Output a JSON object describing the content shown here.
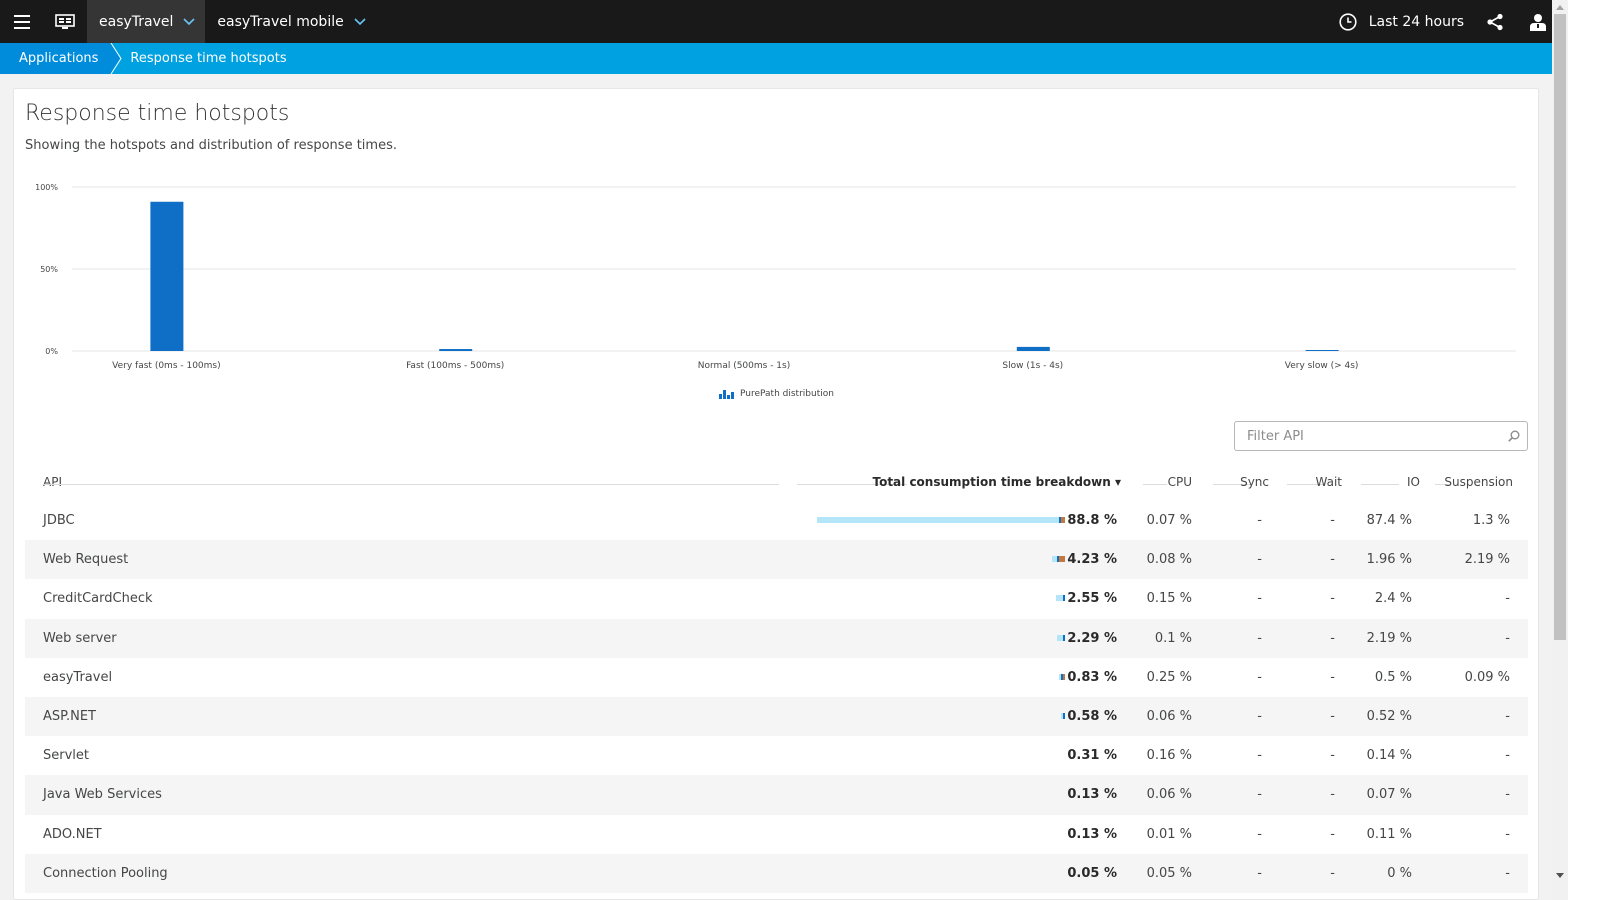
{
  "topbar": {
    "apps": [
      {
        "label": "easyTravel",
        "active": true
      },
      {
        "label": "easyTravel mobile",
        "active": false
      }
    ],
    "timeframe": "Last 24 hours"
  },
  "breadcrumb": {
    "items": [
      "Applications",
      "Response time hotspots"
    ]
  },
  "page": {
    "title": "Response time hotspots",
    "subtitle": "Showing the hotspots and distribution of response times."
  },
  "chart_data": {
    "type": "bar",
    "categories": [
      "Very fast (0ms - 100ms)",
      "Fast (100ms - 500ms)",
      "Normal (500ms - 1s)",
      "Slow (1s - 4s)",
      "Very slow (> 4s)"
    ],
    "values": [
      91,
      1.2,
      0,
      2.5,
      0.6
    ],
    "ytick_labels": [
      "100%",
      "50%",
      "0%"
    ],
    "ylim": [
      0,
      100
    ],
    "yticks": [
      100,
      50,
      0
    ],
    "grid": true,
    "legend": [
      "PurePath distribution"
    ],
    "legend_position": "bottom-center",
    "colors": {
      "bar": "#0f6fc6",
      "grid": "#e6e6e6"
    }
  },
  "filter": {
    "placeholder": "Filter API"
  },
  "table": {
    "headers": {
      "api": "API",
      "total": "Total consumption time breakdown ▾",
      "cpu": "CPU",
      "sync": "Sync",
      "wait": "Wait",
      "io": "IO",
      "suspension": "Suspension"
    },
    "rows": [
      {
        "api": "JDBC",
        "total": "88.8 %",
        "cpu": "0.07 %",
        "sync": "-",
        "wait": "-",
        "io": "87.4 %",
        "suspension": "1.3 %",
        "bar": {
          "io": 87.4,
          "cpu": 0.07,
          "susp": 1.3
        }
      },
      {
        "api": "Web Request",
        "total": "4.23 %",
        "cpu": "0.08 %",
        "sync": "-",
        "wait": "-",
        "io": "1.96 %",
        "suspension": "2.19 %",
        "bar": {
          "io": 1.96,
          "cpu": 0.08,
          "susp": 2.19
        }
      },
      {
        "api": "CreditCardCheck",
        "total": "2.55 %",
        "cpu": "0.15 %",
        "sync": "-",
        "wait": "-",
        "io": "2.4 %",
        "suspension": "-",
        "bar": {
          "io": 2.4,
          "cpu": 0.15,
          "susp": 0
        }
      },
      {
        "api": "Web server",
        "total": "2.29 %",
        "cpu": "0.1 %",
        "sync": "-",
        "wait": "-",
        "io": "2.19 %",
        "suspension": "-",
        "bar": {
          "io": 2.19,
          "cpu": 0.1,
          "susp": 0
        }
      },
      {
        "api": "easyTravel",
        "total": "0.83 %",
        "cpu": "0.25 %",
        "sync": "-",
        "wait": "-",
        "io": "0.5 %",
        "suspension": "0.09 %",
        "bar": {
          "io": 0.5,
          "cpu": 0.25,
          "susp": 0.09
        }
      },
      {
        "api": "ASP.NET",
        "total": "0.58 %",
        "cpu": "0.06 %",
        "sync": "-",
        "wait": "-",
        "io": "0.52 %",
        "suspension": "-",
        "bar": {
          "io": 0.52,
          "cpu": 0.06,
          "susp": 0
        }
      },
      {
        "api": "Servlet",
        "total": "0.31 %",
        "cpu": "0.16 %",
        "sync": "-",
        "wait": "-",
        "io": "0.14 %",
        "suspension": "-",
        "bar": null
      },
      {
        "api": "Java Web Services",
        "total": "0.13 %",
        "cpu": "0.06 %",
        "sync": "-",
        "wait": "-",
        "io": "0.07 %",
        "suspension": "-",
        "bar": null
      },
      {
        "api": "ADO.NET",
        "total": "0.13 %",
        "cpu": "0.01 %",
        "sync": "-",
        "wait": "-",
        "io": "0.11 %",
        "suspension": "-",
        "bar": null
      },
      {
        "api": "Connection Pooling",
        "total": "0.05 %",
        "cpu": "0.05 %",
        "sync": "-",
        "wait": "-",
        "io": "0 %",
        "suspension": "-",
        "bar": null
      }
    ]
  },
  "icons": [
    "hamburger-menu-icon",
    "monitor-icon",
    "chevron-down-icon",
    "clock-icon",
    "share-icon",
    "user-icon",
    "search-icon",
    "bar-chart-icon"
  ]
}
